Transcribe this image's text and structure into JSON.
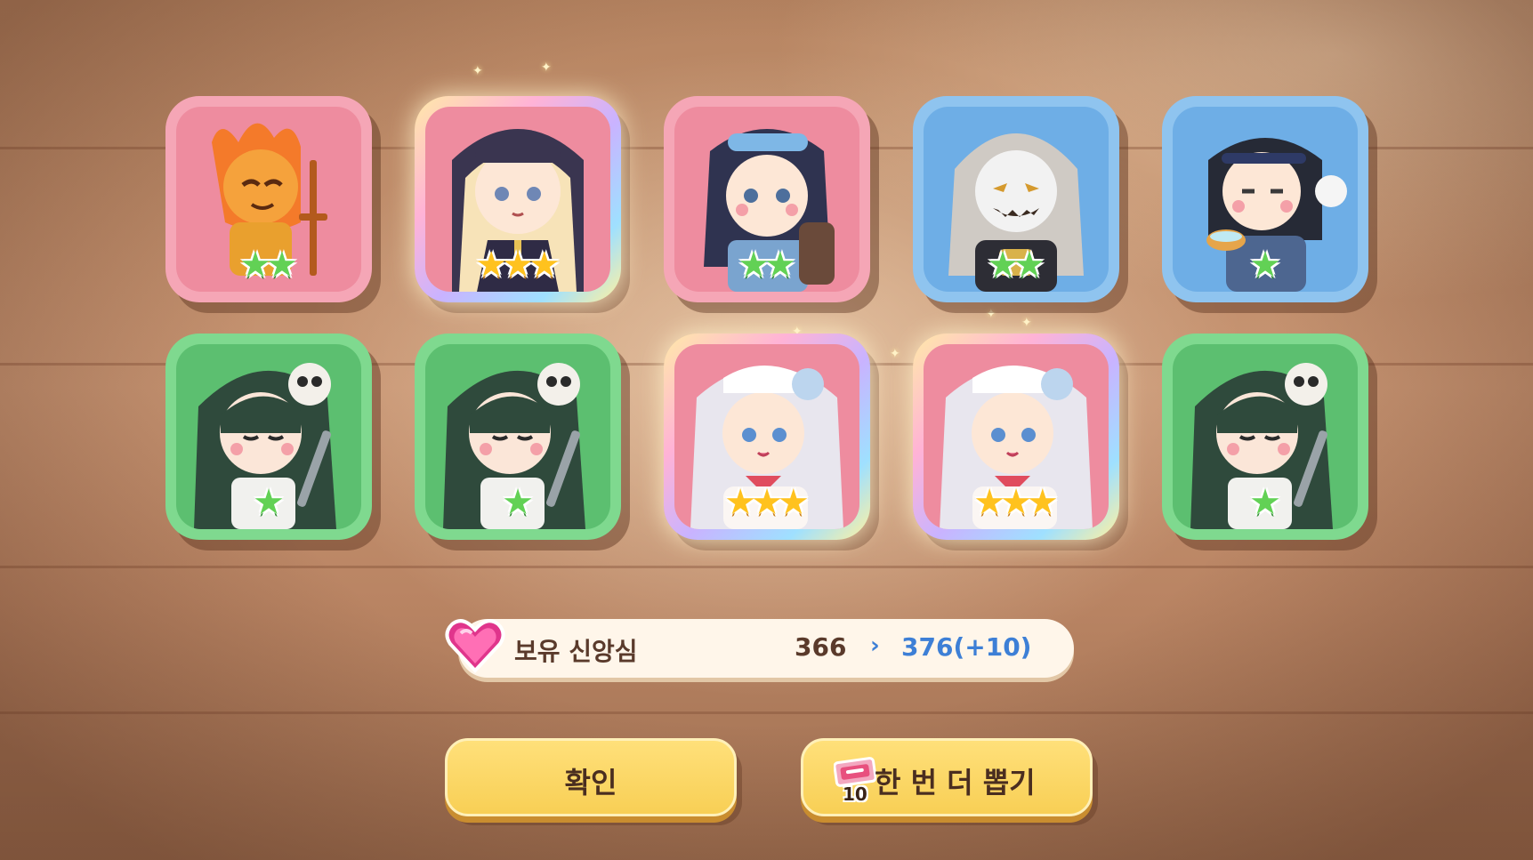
{
  "results": [
    {
      "name": "fire-demon-knight",
      "frame": "pink",
      "stars": 2,
      "star_color": "green",
      "highlight": false
    },
    {
      "name": "blonde-nun",
      "frame": "rainbow",
      "stars": 3,
      "star_color": "gold",
      "highlight": true
    },
    {
      "name": "dark-haired-backpack-girl",
      "frame": "pink",
      "stars": 2,
      "star_color": "green",
      "highlight": false
    },
    {
      "name": "masked-grey-haired-girl",
      "frame": "blue",
      "stars": 2,
      "star_color": "green",
      "highlight": false
    },
    {
      "name": "headband-girl-with-bowl",
      "frame": "blue",
      "stars": 1,
      "star_color": "green",
      "highlight": false
    },
    {
      "name": "green-haired-skull-girl",
      "frame": "green",
      "stars": 1,
      "star_color": "green",
      "highlight": false
    },
    {
      "name": "green-haired-skull-girl",
      "frame": "green",
      "stars": 1,
      "star_color": "green",
      "highlight": false
    },
    {
      "name": "silver-haired-maid",
      "frame": "rainbow",
      "stars": 3,
      "star_color": "gold",
      "highlight": true
    },
    {
      "name": "silver-haired-maid",
      "frame": "rainbow",
      "stars": 3,
      "star_color": "gold",
      "highlight": true
    },
    {
      "name": "green-haired-skull-girl",
      "frame": "green",
      "stars": 1,
      "star_color": "green",
      "highlight": false
    }
  ],
  "faith": {
    "label": "보유 신앙심",
    "current": "366",
    "arrow": "›",
    "new_value": "376(+10)",
    "icon": "pink-heart-gem-icon"
  },
  "buttons": {
    "confirm_label": "확인",
    "redraw_label": "한 번 더 뽑기",
    "redraw_ticket_count": "10",
    "redraw_ticket_icon": "gacha-ticket-icon"
  },
  "colors": {
    "pink_frame": "#f5a6b6",
    "blue_frame": "#8fc4ef",
    "green_frame": "#7fd98f",
    "button_yellow": "#f8cf55",
    "accent_blue": "#3d7fd6"
  }
}
